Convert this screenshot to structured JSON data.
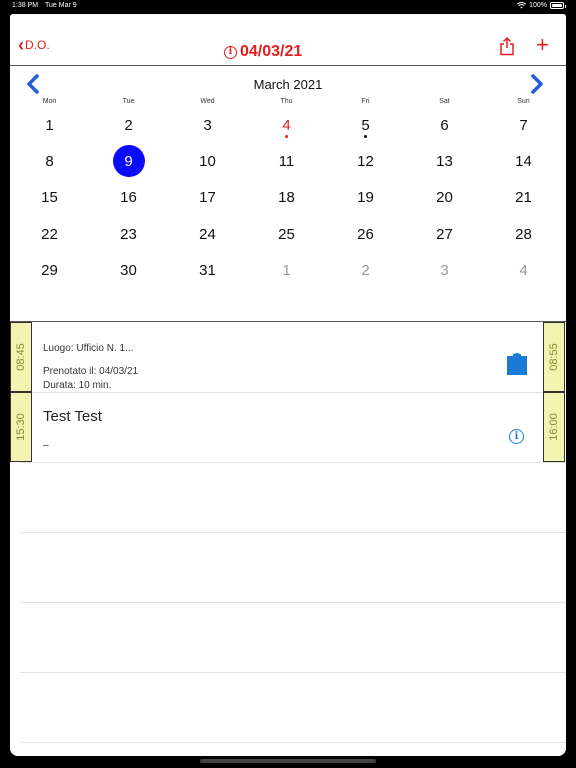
{
  "status_bar": {
    "time": "1:38 PM",
    "date": "Tue Mar 9",
    "battery": "100%"
  },
  "nav": {
    "back_label": "D.O.",
    "title": "04/03/21",
    "add_label": "+"
  },
  "calendar": {
    "month_title": "March 2021",
    "weekdays": [
      "Mon",
      "Tue",
      "Wed",
      "Thu",
      "Fri",
      "Sat",
      "Sun"
    ],
    "days": [
      {
        "n": "1"
      },
      {
        "n": "2"
      },
      {
        "n": "3"
      },
      {
        "n": "4",
        "today": true,
        "dot": true
      },
      {
        "n": "5",
        "dot": true
      },
      {
        "n": "6"
      },
      {
        "n": "7"
      },
      {
        "n": "8"
      },
      {
        "n": "9",
        "selected": true
      },
      {
        "n": "10"
      },
      {
        "n": "11"
      },
      {
        "n": "12"
      },
      {
        "n": "13"
      },
      {
        "n": "14"
      },
      {
        "n": "15"
      },
      {
        "n": "16"
      },
      {
        "n": "17"
      },
      {
        "n": "18"
      },
      {
        "n": "19"
      },
      {
        "n": "20"
      },
      {
        "n": "21"
      },
      {
        "n": "22"
      },
      {
        "n": "23"
      },
      {
        "n": "24"
      },
      {
        "n": "25"
      },
      {
        "n": "26"
      },
      {
        "n": "27"
      },
      {
        "n": "28"
      },
      {
        "n": "29"
      },
      {
        "n": "30"
      },
      {
        "n": "31"
      },
      {
        "n": "1",
        "other": true
      },
      {
        "n": "2",
        "other": true
      },
      {
        "n": "3",
        "other": true
      },
      {
        "n": "4",
        "other": true
      }
    ]
  },
  "events": [
    {
      "start": "08:45",
      "end": "08:55",
      "place": "Luogo: Ufficio N. 1...",
      "booked": "Prenotato il: 04/03/21",
      "duration": "Durata: 10 min."
    },
    {
      "start": "15:30",
      "end": "16:00",
      "title": "Test Test",
      "subtitle": "–"
    }
  ],
  "colors": {
    "accent_red": "#e41e1e",
    "selected_blue": "#0a0aff",
    "icon_blue": "#1a7ad4",
    "time_tab": "#f3f3b0"
  }
}
